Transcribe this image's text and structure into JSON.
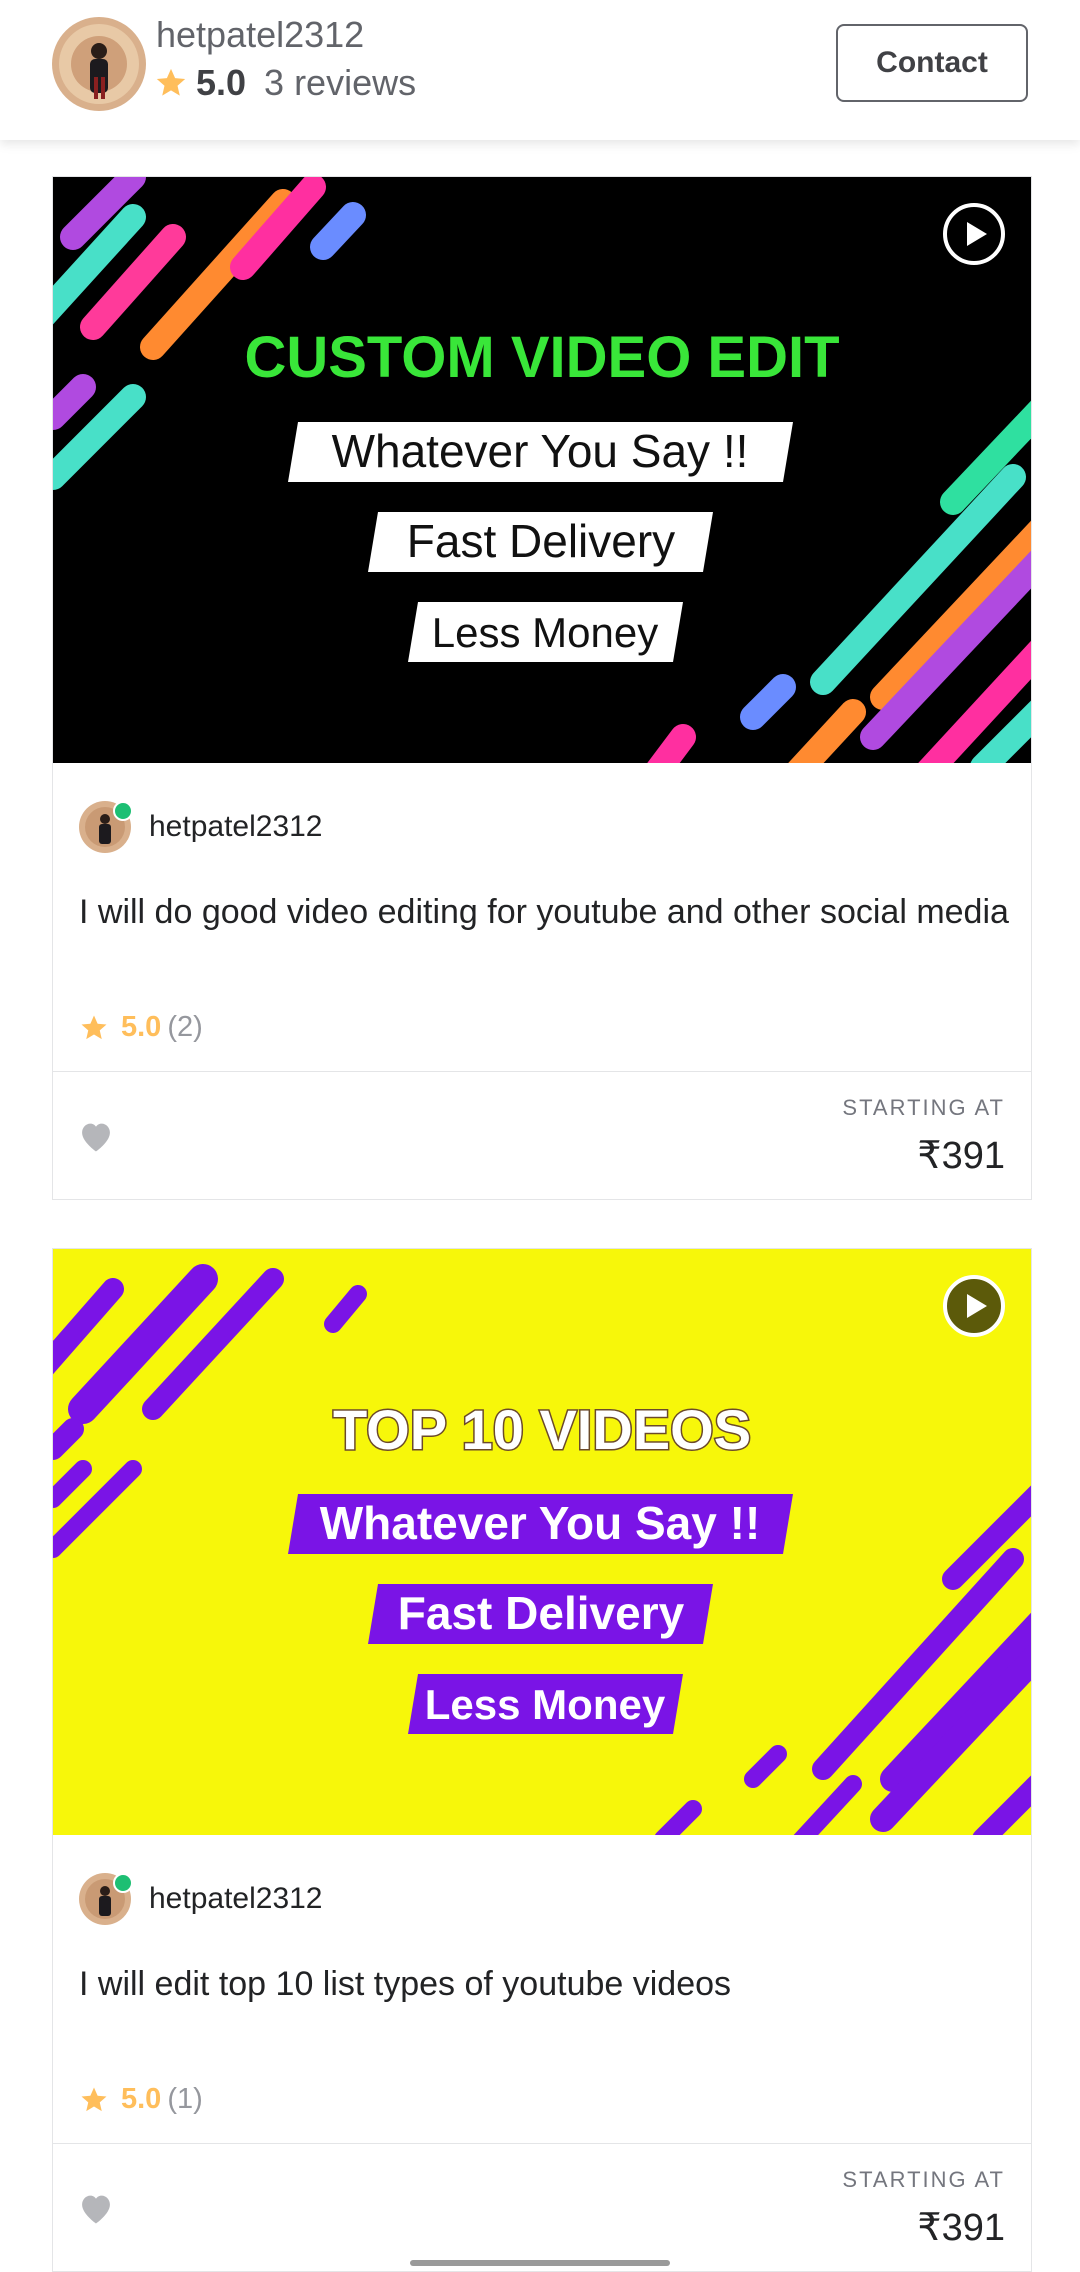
{
  "header": {
    "username": "hetpatel2312",
    "rating": "5.0",
    "reviews": "3 reviews",
    "contact_label": "Contact"
  },
  "gigs": [
    {
      "thumbnail": {
        "headline": "CUSTOM VIDEO EDIT",
        "line1": "Whatever You Say !!",
        "line2": "Fast Delivery",
        "line3": "Less Money"
      },
      "seller": "hetpatel2312",
      "title": "I will do good video editing for youtube and other social media",
      "rating": "5.0",
      "rating_count": "(2)",
      "starting_label": "STARTING AT",
      "price": "₹391"
    },
    {
      "thumbnail": {
        "headline": "TOP 10 VIDEOS",
        "line1": "Whatever You Say !!",
        "line2": "Fast Delivery",
        "line3": "Less Money"
      },
      "seller": "hetpatel2312",
      "title": "I will edit top 10 list types of youtube videos",
      "rating": "5.0",
      "rating_count": "(1)",
      "starting_label": "STARTING AT",
      "price": "₹391"
    }
  ],
  "colors": {
    "accent_green": "#1dbf73",
    "star": "#ffbe5b",
    "thumb1_bg": "#000000",
    "thumb1_headline": "#39e639",
    "thumb2_bg": "#f7f70a",
    "thumb2_accent": "#7a14e6"
  },
  "icons": {
    "star": "star-icon",
    "play": "play-icon",
    "heart": "heart-icon"
  }
}
